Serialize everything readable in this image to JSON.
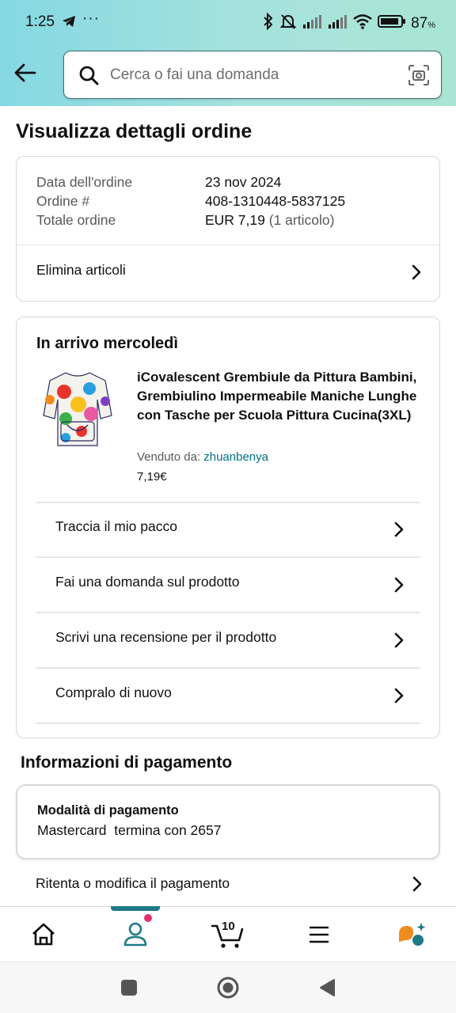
{
  "status_bar": {
    "time": "1:25",
    "dots": "···",
    "battery": "87",
    "battery_unit": "%"
  },
  "header": {
    "search_placeholder": "Cerca o fai una domanda"
  },
  "page_title": "Visualizza dettagli ordine",
  "order_summary": {
    "date_label": "Data dell'ordine",
    "date_value": "23 nov 2024",
    "order_label": "Ordine #",
    "order_value": "408-1310448-5837125",
    "total_label": "Totale ordine",
    "total_value": "EUR 7,19",
    "total_items": "(1 articolo)",
    "delete_label": "Elimina articoli"
  },
  "shipment": {
    "arrival": "In arrivo mercoledì",
    "product_name": "iCovalescent Grembiule da Pittura Bambini, Grembiulino Impermeabile Maniche Lunghe con Tasche per Scuola Pittura Cucina(3XL)",
    "sold_by_label": "Venduto da:",
    "seller": "zhuanbenya",
    "price": "7,19€",
    "actions": [
      {
        "label": "Traccia il mio pacco"
      },
      {
        "label": "Fai una domanda sul prodotto"
      },
      {
        "label": "Scrivi una recensione per il prodotto"
      },
      {
        "label": "Compralo di nuovo"
      }
    ]
  },
  "payment": {
    "section_title": "Informazioni di pagamento",
    "method_label": "Modalità di pagamento",
    "method_value": "Mastercard  termina con 2657",
    "retry_label": "Ritenta o modifica il pagamento"
  },
  "bottom_nav": {
    "cart_count": "10",
    "active_tab": "account",
    "accent_color": "#1f7a86",
    "badge_color": "#e3306a",
    "icons": [
      "home-icon",
      "account-icon",
      "cart-icon",
      "menu-icon",
      "assistant-icon"
    ]
  }
}
